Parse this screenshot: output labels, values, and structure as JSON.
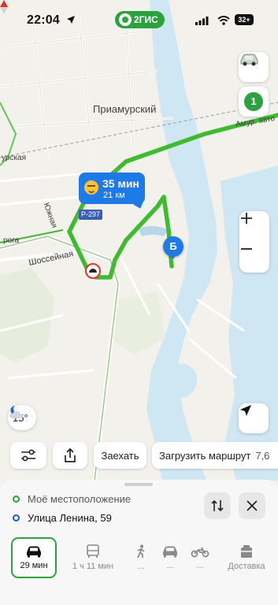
{
  "status_bar": {
    "time": "22:04",
    "app_badge": "2ГИС",
    "battery": "32+"
  },
  "map": {
    "place_name": "Приамурский",
    "road_labels": {
      "amur": "Амур. авто",
      "left": "урская",
      "south": "Южная",
      "shosseynaya": "Шоссейная",
      "roga": "рога"
    },
    "route_sign": "Р-297",
    "route_bubble": {
      "time": "35 мин",
      "distance": "21 км"
    },
    "destination_marker": "Б",
    "weather": {
      "temperature": "15°",
      "icon": "moon-cloud-icon"
    },
    "counter_badge": "1",
    "colors": {
      "route": "#3fbb2f",
      "accent": "#2aa33f",
      "marker": "#1e7ae6",
      "water": "#cfe6f3"
    }
  },
  "actions": {
    "enter": "Заехать",
    "load_route": "Загрузить маршрут",
    "load_route_price": "7,6"
  },
  "route_panel": {
    "from": "Моё местоположение",
    "to": "Улица Ленина, 59"
  },
  "transport_modes": [
    {
      "id": "car",
      "label": "29 мин",
      "icon": "car-icon",
      "selected": true
    },
    {
      "id": "bus",
      "label": "1 ч 11 мин",
      "icon": "bus-icon"
    },
    {
      "id": "walk",
      "label": "...",
      "icon": "walking-icon"
    },
    {
      "id": "taxi",
      "label": "...",
      "icon": "taxi-icon"
    },
    {
      "id": "moto",
      "label": "...",
      "icon": "motorcycle-icon"
    },
    {
      "id": "delivery",
      "label": "Доставка",
      "icon": "delivery-icon"
    }
  ]
}
